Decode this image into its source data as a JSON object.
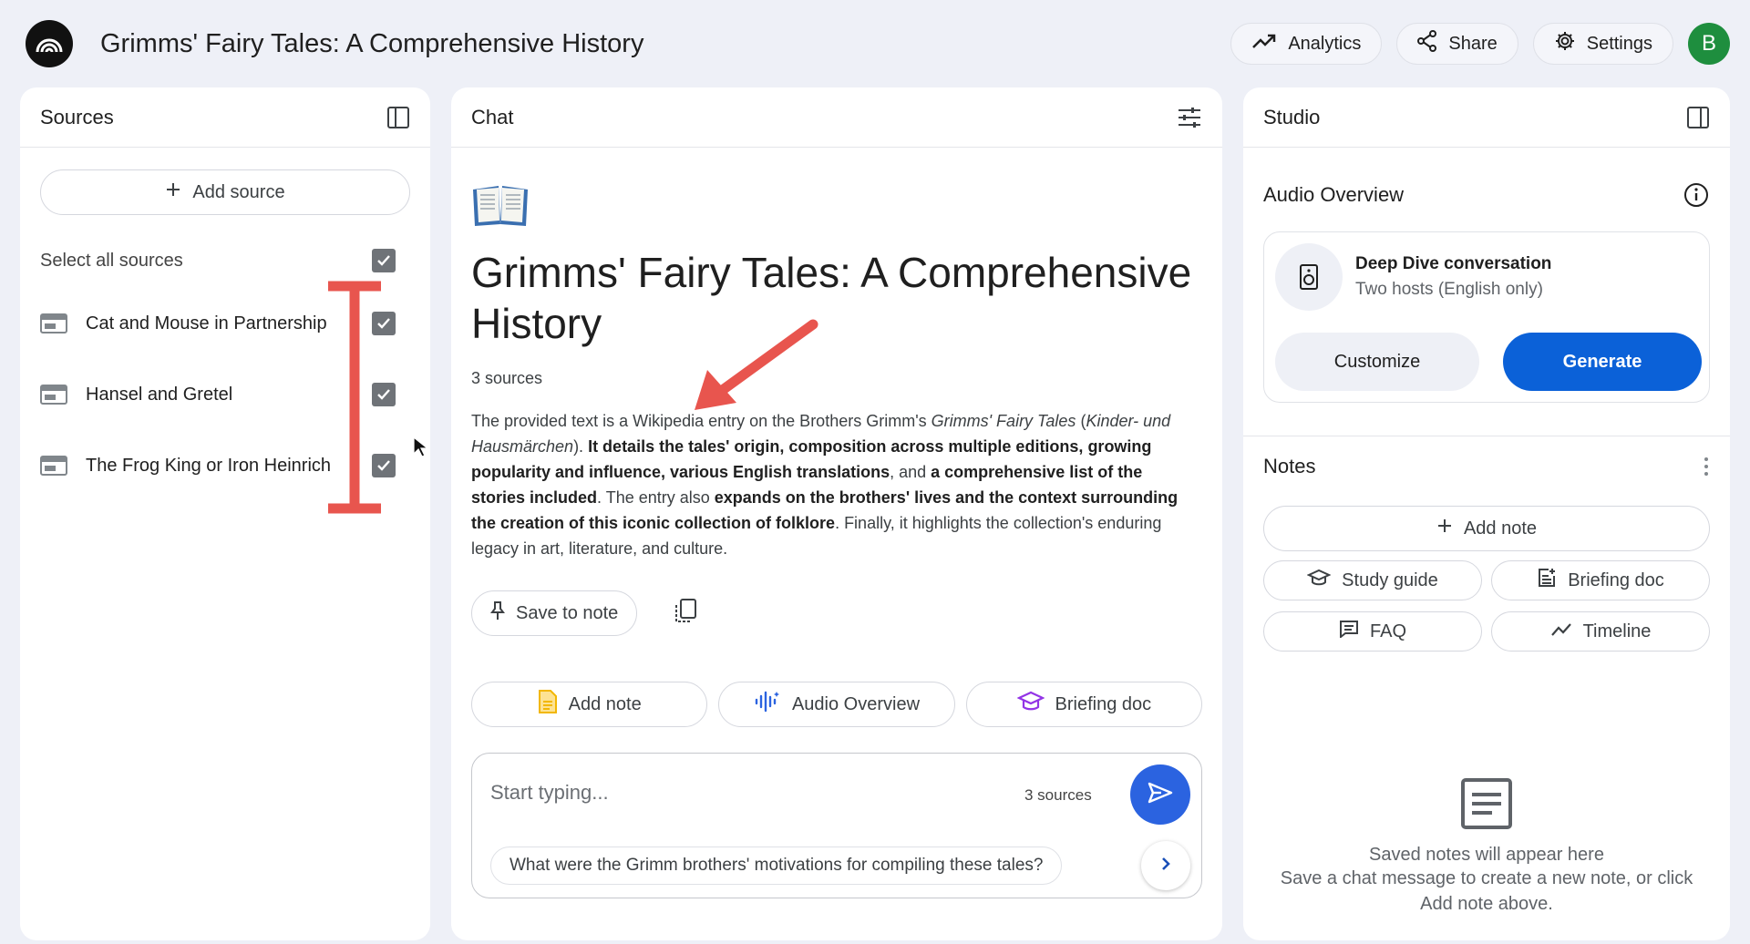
{
  "app": {
    "title": "Grimms' Fairy Tales: A Comprehensive History",
    "logo_icon": "notebooklm-logo-icon"
  },
  "header": {
    "analytics_label": "Analytics",
    "share_label": "Share",
    "settings_label": "Settings",
    "avatar_initial": "B",
    "avatar_color": "#1e8e3e"
  },
  "sources": {
    "title": "Sources",
    "add_source_label": "Add source",
    "select_all_label": "Select all sources",
    "select_all_checked": true,
    "items": [
      {
        "label": "Cat and Mouse in Partnership",
        "checked": true,
        "icon": "document-icon"
      },
      {
        "label": "Hansel and Gretel",
        "checked": true,
        "icon": "document-icon"
      },
      {
        "label": "The Frog King or Iron Heinrich",
        "checked": true,
        "icon": "document-icon"
      }
    ]
  },
  "chat": {
    "title": "Chat",
    "emoji": "📖",
    "notebook_title": "Grimms' Fairy Tales: A Comprehensive History",
    "source_count": "3 sources",
    "summary": {
      "p1": "The provided text is a Wikipedia entry on the Brothers Grimm's ",
      "p2": "Grimms' Fairy Tales",
      "p3": " (",
      "p4": "Kinder- und Hausmärchen",
      "p5": "). ",
      "p6": "It details the tales' origin, composition across multiple editions, growing popularity and influence, various English translations",
      "p7": ", and ",
      "p8": "a comprehensive list of the stories included",
      "p9": ". The entry also ",
      "p10": "expands on the brothers' lives and the context surrounding the creation of this iconic collection of folklore",
      "p11": ". Finally, it highlights the collection's enduring legacy in art, literature, and culture."
    },
    "save_to_note_label": "Save to note",
    "suggested_actions": [
      {
        "label": "Add note",
        "icon": "note-icon",
        "color": "#f2b705"
      },
      {
        "label": "Audio Overview",
        "icon": "audio-waveform-icon",
        "color": "#2b63e0"
      },
      {
        "label": "Briefing doc",
        "icon": "graduation-cap-icon",
        "color": "#9334e6"
      }
    ],
    "input_placeholder": "Start typing...",
    "input_source_count": "3 sources",
    "suggested_question": "What were the Grimm brothers' motivations for compiling these tales?"
  },
  "studio": {
    "title": "Studio",
    "audio_overview_title": "Audio Overview",
    "card_title": "Deep Dive conversation",
    "card_subtitle": "Two hosts (English only)",
    "customize_label": "Customize",
    "generate_label": "Generate",
    "generate_color": "#0b61d8",
    "notes_title": "Notes",
    "add_note_label": "Add note",
    "note_buttons": [
      {
        "label": "Study guide",
        "icon": "graduation-cap-icon"
      },
      {
        "label": "Briefing doc",
        "icon": "briefing-doc-icon"
      },
      {
        "label": "FAQ",
        "icon": "faq-icon"
      },
      {
        "label": "Timeline",
        "icon": "timeline-icon"
      }
    ],
    "empty_title": "Saved notes will appear here",
    "empty_subtitle": "Save a chat message to create a new note, or click Add note above."
  },
  "annotations": {
    "bracket_color": "#e8554e",
    "arrow_color": "#e8554e"
  }
}
